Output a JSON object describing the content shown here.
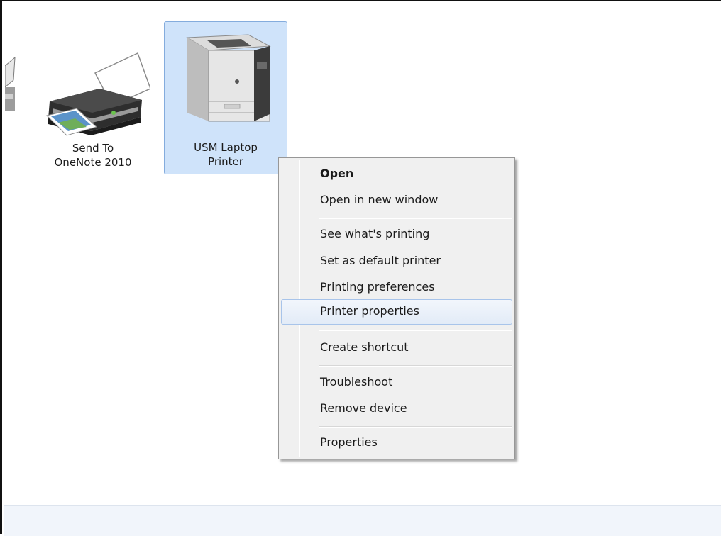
{
  "devices": [
    {
      "label_line1": "",
      "label_line2": ""
    },
    {
      "label_line1": "Send To",
      "label_line2": "OneNote 2010"
    },
    {
      "label_line1": "USM Laptop",
      "label_line2": "Printer"
    }
  ],
  "context_menu": {
    "items": [
      {
        "label": "Open"
      },
      {
        "label": "Open in new window"
      },
      {
        "label": "See what's printing"
      },
      {
        "label": "Set as default printer"
      },
      {
        "label": "Printing preferences"
      },
      {
        "label": "Printer properties"
      },
      {
        "label": "Create shortcut"
      },
      {
        "label": "Troubleshoot"
      },
      {
        "label": "Remove device"
      },
      {
        "label": "Properties"
      }
    ]
  },
  "colors": {
    "selection_fill": "#cfe3fa",
    "selection_border": "#84acdd",
    "menu_background": "#f0f0f0",
    "hover_border": "#a8c4ea"
  }
}
